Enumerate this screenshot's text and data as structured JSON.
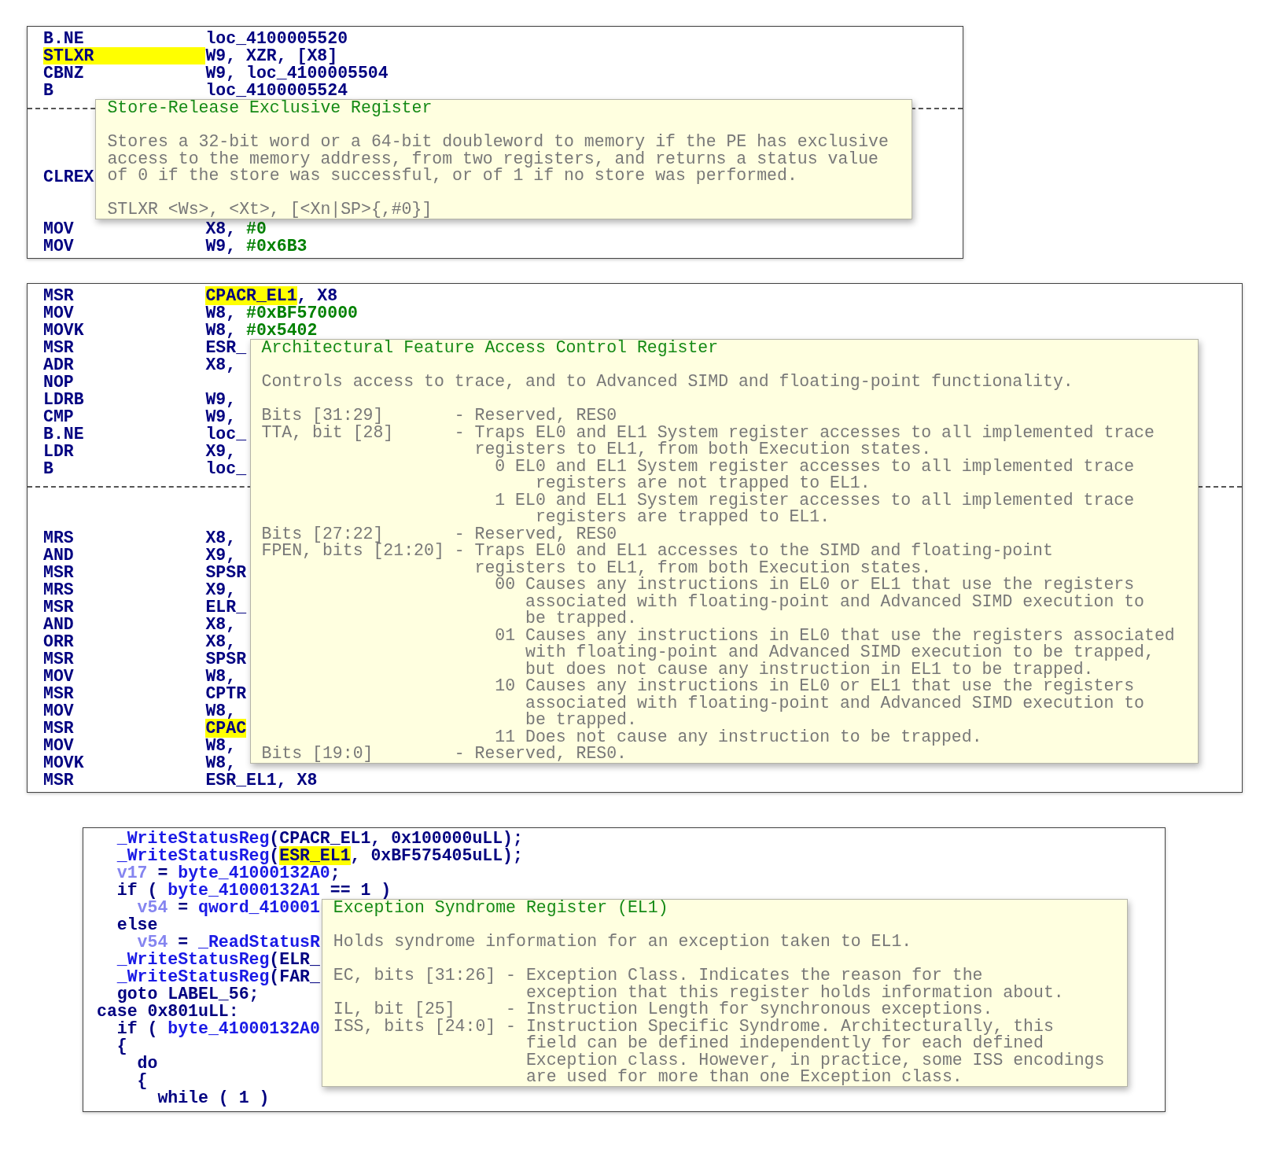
{
  "panels": [
    {
      "kind": "disassembly",
      "lines": [
        {
          "kind": "instr",
          "mnemonic": {
            "kind": "op",
            "text": "B.NE"
          },
          "operands": [
            {
              "kind": "op",
              "text": "loc_4100005520"
            }
          ]
        },
        {
          "kind": "instr",
          "mnemonic": {
            "kind": "hl",
            "text": "STLXR"
          },
          "operands": [
            {
              "kind": "op",
              "text": "W9, XZR, [X8]"
            }
          ]
        },
        {
          "kind": "instr",
          "mnemonic": {
            "kind": "op",
            "text": "CBNZ"
          },
          "operands": [
            {
              "kind": "op",
              "text": "W9, loc_4100005504"
            }
          ]
        },
        {
          "kind": "instr",
          "mnemonic": {
            "kind": "op",
            "text": "B"
          },
          "operands": [
            {
              "kind": "op",
              "text": "loc_4100005524"
            }
          ]
        },
        {
          "kind": "separator"
        },
        {
          "kind": "blank"
        },
        {
          "kind": "blank"
        },
        {
          "kind": "blank"
        },
        {
          "kind": "instr",
          "mnemonic": {
            "kind": "op",
            "text": "CLREX"
          }
        },
        {
          "kind": "blank"
        },
        {
          "kind": "blank"
        },
        {
          "kind": "instr",
          "mnemonic": {
            "kind": "op",
            "text": "MOV"
          },
          "operands": [
            {
              "kind": "op",
              "text": "X8, "
            },
            {
              "kind": "num",
              "text": "#0"
            }
          ]
        },
        {
          "kind": "instr",
          "mnemonic": {
            "kind": "op",
            "text": "MOV"
          },
          "operands": [
            {
              "kind": "op",
              "text": "W9, "
            },
            {
              "kind": "num",
              "text": "#0x6B3"
            }
          ]
        }
      ],
      "tooltip": {
        "title": "Store-Release Exclusive Register",
        "description": "Stores a 32-bit word or a 64-bit doubleword to memory if the PE has exclusive\naccess to the memory address, from two registers, and returns a status value\nof 0 if the store was successful, or of 1 if no store was performed.",
        "syntax": "STLXR <Ws>, <Xt>, [<Xn|SP>{,#0}]"
      }
    },
    {
      "kind": "disassembly",
      "lines": [
        {
          "kind": "instr",
          "mnemonic": {
            "kind": "op",
            "text": "MSR"
          },
          "operands": [
            {
              "kind": "hl",
              "text": "CPACR_EL1"
            },
            {
              "kind": "op",
              "text": ", X8"
            }
          ]
        },
        {
          "kind": "instr",
          "mnemonic": {
            "kind": "op",
            "text": "MOV"
          },
          "operands": [
            {
              "kind": "op",
              "text": "W8, "
            },
            {
              "kind": "num",
              "text": "#0xBF570000"
            }
          ]
        },
        {
          "kind": "instr",
          "mnemonic": {
            "kind": "op",
            "text": "MOVK"
          },
          "operands": [
            {
              "kind": "op",
              "text": "W8, "
            },
            {
              "kind": "num",
              "text": "#0x5402"
            }
          ]
        },
        {
          "kind": "instr",
          "mnemonic": {
            "kind": "op",
            "text": "MSR"
          },
          "operands": [
            {
              "kind": "op",
              "text": "ESR_"
            }
          ]
        },
        {
          "kind": "instr",
          "mnemonic": {
            "kind": "op",
            "text": "ADR"
          },
          "operands": [
            {
              "kind": "op",
              "text": "X8,"
            }
          ]
        },
        {
          "kind": "instr",
          "mnemonic": {
            "kind": "op",
            "text": "NOP"
          }
        },
        {
          "kind": "instr",
          "mnemonic": {
            "kind": "op",
            "text": "LDRB"
          },
          "operands": [
            {
              "kind": "op",
              "text": "W9,"
            }
          ]
        },
        {
          "kind": "instr",
          "mnemonic": {
            "kind": "op",
            "text": "CMP"
          },
          "operands": [
            {
              "kind": "op",
              "text": "W9,"
            }
          ]
        },
        {
          "kind": "instr",
          "mnemonic": {
            "kind": "op",
            "text": "B.NE"
          },
          "operands": [
            {
              "kind": "op",
              "text": "loc_"
            }
          ]
        },
        {
          "kind": "instr",
          "mnemonic": {
            "kind": "op",
            "text": "LDR"
          },
          "operands": [
            {
              "kind": "op",
              "text": "X9,"
            }
          ]
        },
        {
          "kind": "instr",
          "mnemonic": {
            "kind": "op",
            "text": "B"
          },
          "operands": [
            {
              "kind": "op",
              "text": "loc_"
            }
          ]
        },
        {
          "kind": "separator"
        },
        {
          "kind": "blank"
        },
        {
          "kind": "blank"
        },
        {
          "kind": "instr",
          "mnemonic": {
            "kind": "op",
            "text": "MRS"
          },
          "operands": [
            {
              "kind": "op",
              "text": "X8,"
            }
          ]
        },
        {
          "kind": "instr",
          "mnemonic": {
            "kind": "op",
            "text": "AND"
          },
          "operands": [
            {
              "kind": "op",
              "text": "X9,"
            }
          ]
        },
        {
          "kind": "instr",
          "mnemonic": {
            "kind": "op",
            "text": "MSR"
          },
          "operands": [
            {
              "kind": "op",
              "text": "SPSR"
            }
          ]
        },
        {
          "kind": "instr",
          "mnemonic": {
            "kind": "op",
            "text": "MRS"
          },
          "operands": [
            {
              "kind": "op",
              "text": "X9,"
            }
          ]
        },
        {
          "kind": "instr",
          "mnemonic": {
            "kind": "op",
            "text": "MSR"
          },
          "operands": [
            {
              "kind": "op",
              "text": "ELR_"
            }
          ]
        },
        {
          "kind": "instr",
          "mnemonic": {
            "kind": "op",
            "text": "AND"
          },
          "operands": [
            {
              "kind": "op",
              "text": "X8,"
            }
          ]
        },
        {
          "kind": "instr",
          "mnemonic": {
            "kind": "op",
            "text": "ORR"
          },
          "operands": [
            {
              "kind": "op",
              "text": "X8,"
            }
          ]
        },
        {
          "kind": "instr",
          "mnemonic": {
            "kind": "op",
            "text": "MSR"
          },
          "operands": [
            {
              "kind": "op",
              "text": "SPSR"
            }
          ]
        },
        {
          "kind": "instr",
          "mnemonic": {
            "kind": "op",
            "text": "MOV"
          },
          "operands": [
            {
              "kind": "op",
              "text": "W8,"
            }
          ]
        },
        {
          "kind": "instr",
          "mnemonic": {
            "kind": "op",
            "text": "MSR"
          },
          "operands": [
            {
              "kind": "op",
              "text": "CPTR"
            }
          ]
        },
        {
          "kind": "instr",
          "mnemonic": {
            "kind": "op",
            "text": "MOV"
          },
          "operands": [
            {
              "kind": "op",
              "text": "W8,"
            }
          ]
        },
        {
          "kind": "instr",
          "mnemonic": {
            "kind": "op",
            "text": "MSR"
          },
          "operands": [
            {
              "kind": "hl",
              "text": "CPAC"
            }
          ]
        },
        {
          "kind": "instr",
          "mnemonic": {
            "kind": "op",
            "text": "MOV"
          },
          "operands": [
            {
              "kind": "op",
              "text": "W8,"
            }
          ]
        },
        {
          "kind": "instr",
          "mnemonic": {
            "kind": "op",
            "text": "MOVK"
          },
          "operands": [
            {
              "kind": "op",
              "text": "W8,"
            }
          ]
        },
        {
          "kind": "instr",
          "mnemonic": {
            "kind": "op",
            "text": "MSR"
          },
          "operands": [
            {
              "kind": "op",
              "text": "ESR_EL1, X8"
            }
          ]
        }
      ],
      "tooltip": {
        "title": "Architectural Feature Access Control Register",
        "description": "Controls access to trace, and to Advanced SIMD and floating-point functionality.",
        "fields": [
          {
            "term": "Bits [31:29]",
            "text": "- Reserved, RES0"
          },
          {
            "term": "TTA, bit [28]",
            "text": "- Traps EL0 and EL1 System register accesses to all implemented trace\n  registers to EL1, from both Execution states.",
            "values": [
              {
                "code": "0",
                "text": "EL0 and EL1 System register accesses to all implemented trace\n  registers are not trapped to EL1."
              },
              {
                "code": "1",
                "text": "EL0 and EL1 System register accesses to all implemented trace\n  registers are trapped to EL1."
              }
            ]
          },
          {
            "term": "Bits [27:22]",
            "text": "- Reserved, RES0"
          },
          {
            "term": "FPEN, bits [21:20]",
            "text": "- Traps EL0 and EL1 accesses to the SIMD and floating-point\n  registers to EL1, from both Execution states.",
            "values": [
              {
                "code": "00",
                "text": "Causes any instructions in EL0 or EL1 that use the registers\nassociated with floating-point and Advanced SIMD execution to\nbe trapped."
              },
              {
                "code": "01",
                "text": "Causes any instructions in EL0 that use the registers associated\nwith floating-point and Advanced SIMD execution to be trapped,\nbut does not cause any instruction in EL1 to be trapped."
              },
              {
                "code": "10",
                "text": "Causes any instructions in EL0 or EL1 that use the registers\nassociated with floating-point and Advanced SIMD execution to\nbe trapped."
              },
              {
                "code": "11",
                "text": "Does not cause any instruction to be trapped."
              }
            ]
          },
          {
            "term": "Bits [19:0]",
            "text": "- Reserved, RES0."
          }
        ]
      }
    },
    {
      "kind": "pseudocode",
      "lines": [
        {
          "kind": "code",
          "tokens": [
            {
              "kind": "fn",
              "text": "  _WriteStatusReg"
            },
            {
              "kind": "op",
              "text": "(CPACR_EL1, 0x100000uLL);"
            }
          ]
        },
        {
          "kind": "code",
          "tokens": [
            {
              "kind": "fn",
              "text": "  _WriteStatusReg"
            },
            {
              "kind": "op",
              "text": "("
            },
            {
              "kind": "hl",
              "text": "ESR_EL1"
            },
            {
              "kind": "op",
              "text": ", 0xBF575405uLL);"
            }
          ]
        },
        {
          "kind": "code",
          "tokens": [
            {
              "kind": "var",
              "text": "  v17"
            },
            {
              "kind": "op",
              "text": " = "
            },
            {
              "kind": "fn",
              "text": "byte_41000132A0"
            },
            {
              "kind": "op",
              "text": ";"
            }
          ]
        },
        {
          "kind": "code",
          "tokens": [
            {
              "kind": "op",
              "text": "  if ( "
            },
            {
              "kind": "fn",
              "text": "byte_41000132A1"
            },
            {
              "kind": "op",
              "text": " == 1 )"
            }
          ]
        },
        {
          "kind": "code",
          "tokens": [
            {
              "kind": "var",
              "text": "    v54"
            },
            {
              "kind": "op",
              "text": " = "
            },
            {
              "kind": "fn",
              "text": "qword_410001"
            }
          ]
        },
        {
          "kind": "code",
          "tokens": [
            {
              "kind": "op",
              "text": "  else"
            }
          ]
        },
        {
          "kind": "code",
          "tokens": [
            {
              "kind": "var",
              "text": "    v54"
            },
            {
              "kind": "op",
              "text": " = "
            },
            {
              "kind": "fn",
              "text": "_ReadStatusR"
            }
          ]
        },
        {
          "kind": "code",
          "tokens": [
            {
              "kind": "fn",
              "text": "  _WriteStatusReg"
            },
            {
              "kind": "op",
              "text": "(ELR_"
            }
          ]
        },
        {
          "kind": "code",
          "tokens": [
            {
              "kind": "fn",
              "text": "  _WriteStatusReg"
            },
            {
              "kind": "op",
              "text": "(FAR_"
            }
          ]
        },
        {
          "kind": "code",
          "tokens": [
            {
              "kind": "op",
              "text": "  goto LABEL_56;"
            }
          ]
        },
        {
          "kind": "code",
          "tokens": [
            {
              "kind": "op",
              "text": "case 0x801uLL:"
            }
          ]
        },
        {
          "kind": "code",
          "tokens": [
            {
              "kind": "op",
              "text": "  if ( "
            },
            {
              "kind": "fn",
              "text": "byte_41000132A0"
            }
          ]
        },
        {
          "kind": "code",
          "tokens": [
            {
              "kind": "op",
              "text": "  {"
            }
          ]
        },
        {
          "kind": "code",
          "tokens": [
            {
              "kind": "op",
              "text": "    do"
            }
          ]
        },
        {
          "kind": "code",
          "tokens": [
            {
              "kind": "op",
              "text": "    {"
            }
          ]
        },
        {
          "kind": "code",
          "tokens": [
            {
              "kind": "op",
              "text": "      while ( 1 )"
            }
          ]
        }
      ],
      "tooltip": {
        "title": "Exception Syndrome Register (EL1)",
        "description": "Holds syndrome information for an exception taken to EL1.",
        "fields": [
          {
            "term": "EC, bits [31:26]",
            "text": "- Exception Class. Indicates the reason for the\n  exception that this register holds information about."
          },
          {
            "term": "IL, bit [25]",
            "text": "- Instruction Length for synchronous exceptions."
          },
          {
            "term": "ISS, bits [24:0]",
            "text": "- Instruction Specific Syndrome. Architecturally, this\n  field can be defined independently for each defined\n  Exception class. However, in practice, some ISS encodings\n  are used for more than one Exception class."
          }
        ]
      }
    }
  ]
}
